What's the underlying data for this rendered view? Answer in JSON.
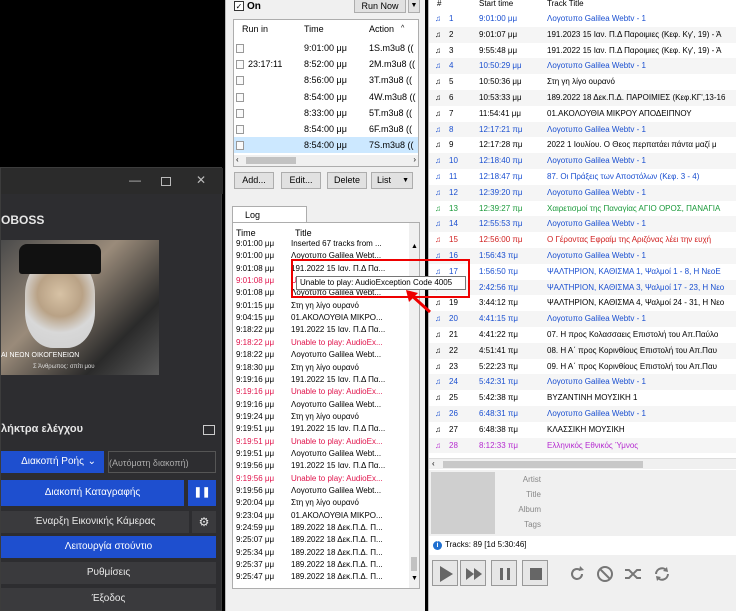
{
  "broadcaster": {
    "app_title": "OBOSS",
    "video_caption": "ΑΙ ΝΕΩΝ ΟΙΚΟΓΕΝΕΙΩΝ",
    "video_subcaption": "Σ Άνθρωπος: σπίτι μου",
    "controls_title": "λήκτρα ελέγχου",
    "stop_flow": "Διακοπή Ροής",
    "auto_stop": "(Αυτόματη διακοπή)",
    "stop_recording": "Διακοπή Καταγραφής",
    "start_webcam": "Έναρξη Εικονικής Κάμερας",
    "studio_mode": "Λειτουργία στούντιο",
    "settings": "Ρυθμίσεις",
    "exit": "Έξοδος"
  },
  "scheduler": {
    "on_label": "On",
    "run_now": "Run Now",
    "columns": [
      "Run in",
      "Time",
      "Action"
    ],
    "rows": [
      {
        "run_in": "",
        "time": "9:01:00 μμ",
        "action": "1S.m3u8 (("
      },
      {
        "run_in": "23:17:11",
        "time": "8:52:00 μμ",
        "action": "2M.m3u8 (("
      },
      {
        "run_in": "",
        "time": "8:56:00 μμ",
        "action": "3T.m3u8 (("
      },
      {
        "run_in": "",
        "time": "8:54:00 μμ",
        "action": "4W.m3u8 (("
      },
      {
        "run_in": "",
        "time": "8:33:00 μμ",
        "action": "5T.m3u8 (("
      },
      {
        "run_in": "",
        "time": "8:54:00 μμ",
        "action": "6F.m3u8 (("
      },
      {
        "run_in": "",
        "time": "8:54:00 μμ",
        "action": "7S.m3u8 (("
      }
    ],
    "buttons": [
      "Add...",
      "Edit...",
      "Delete",
      "List"
    ]
  },
  "log": {
    "tab": "Log",
    "columns": [
      "Time",
      "Title"
    ],
    "rows": [
      {
        "time": "9:01:00 μμ",
        "title": "Inserted 67 tracks from ...",
        "err": false
      },
      {
        "time": "9:01:00 μμ",
        "title": "Λογοτυπο Galilea Webt...",
        "err": false
      },
      {
        "time": "9:01:08 μμ",
        "title": "191.2022 15 Ιαν. Π.Δ Πα...",
        "err": false
      },
      {
        "time": "9:01:08 μμ",
        "title": "Unable to play: AudioEx...",
        "err": true
      },
      {
        "time": "9:01:08 μμ",
        "title": "Λογοτυπο Galilea Webt...",
        "err": false
      },
      {
        "time": "9:01:15 μμ",
        "title": "Στη γη λίγο ουρανό",
        "err": false
      },
      {
        "time": "9:04:15 μμ",
        "title": "01.ΑΚΟΛΟΥΘΙΑ ΜΙΚΡΟ...",
        "err": false
      },
      {
        "time": "9:18:22 μμ",
        "title": "191.2022 15 Ιαν. Π.Δ Πα...",
        "err": false
      },
      {
        "time": "9:18:22 μμ",
        "title": "Unable to play: AudioEx...",
        "err": true
      },
      {
        "time": "9:18:22 μμ",
        "title": "Λογοτυπο Galilea Webt...",
        "err": false
      },
      {
        "time": "9:18:30 μμ",
        "title": "Στη γη λίγο ουρανό",
        "err": false
      },
      {
        "time": "9:19:16 μμ",
        "title": "191.2022 15 Ιαν. Π.Δ Πα...",
        "err": false
      },
      {
        "time": "9:19:16 μμ",
        "title": "Unable to play: AudioEx...",
        "err": true
      },
      {
        "time": "9:19:16 μμ",
        "title": "Λογοτυπο Galilea Webt...",
        "err": false
      },
      {
        "time": "9:19:24 μμ",
        "title": "Στη γη λίγο ουρανό",
        "err": false
      },
      {
        "time": "9:19:51 μμ",
        "title": "191.2022 15 Ιαν. Π.Δ Πα...",
        "err": false
      },
      {
        "time": "9:19:51 μμ",
        "title": "Unable to play: AudioEx...",
        "err": true
      },
      {
        "time": "9:19:51 μμ",
        "title": "Λογοτυπο Galilea Webt...",
        "err": false
      },
      {
        "time": "9:19:56 μμ",
        "title": "191.2022 15 Ιαν. Π.Δ Πα...",
        "err": false
      },
      {
        "time": "9:19:56 μμ",
        "title": "Unable to play: AudioEx...",
        "err": true
      },
      {
        "time": "9:19:56 μμ",
        "title": "Λογοτυπο Galilea Webt...",
        "err": false
      },
      {
        "time": "9:20:04 μμ",
        "title": "Στη γη λίγο ουρανό",
        "err": false
      },
      {
        "time": "9:23:04 μμ",
        "title": "01.ΑΚΟΛΟΥΘΙΑ ΜΙΚΡΟ...",
        "err": false
      },
      {
        "time": "9:24:59 μμ",
        "title": "189.2022 18 Δεκ.Π.Δ. Π...",
        "err": false
      },
      {
        "time": "9:25:07 μμ",
        "title": "189.2022 18 Δεκ.Π.Δ. Π...",
        "err": false
      },
      {
        "time": "9:25:34 μμ",
        "title": "189.2022 18 Δεκ.Π.Δ. Π...",
        "err": false
      },
      {
        "time": "9:25:37 μμ",
        "title": "189.2022 18 Δεκ.Π.Δ. Π...",
        "err": false
      },
      {
        "time": "9:25:47 μμ",
        "title": "189.2022 18 Δεκ.Π.Δ. Π...",
        "err": false
      }
    ],
    "tooltip": "Unable to play: AudioException Code 4005"
  },
  "playlist": {
    "columns": [
      "#",
      "Start time",
      "Track Title"
    ],
    "rows": [
      {
        "n": "1",
        "time": "9:01:00 μμ",
        "title": "Λογοτυπο Galilea Webtv - 1",
        "color": "#1a4fd0"
      },
      {
        "n": "2",
        "time": "9:01:07 μμ",
        "title": "191.2023 15 Ιαν. Π.Δ Παροιμιες (Κεφ. Κγ', 19) - Ά",
        "color": "#000000"
      },
      {
        "n": "3",
        "time": "9:55:48 μμ",
        "title": "191.2022 15 Ιαν. Π.Δ Παροιμιες (Κεφ. Κγ', 19) - Ά",
        "color": "#000000"
      },
      {
        "n": "4",
        "time": "10:50:29 μμ",
        "title": "Λογοτυπο Galilea Webtv - 1",
        "color": "#1a4fd0"
      },
      {
        "n": "5",
        "time": "10:50:36 μμ",
        "title": "Στη γη λίγο ουρανό",
        "color": "#000000"
      },
      {
        "n": "6",
        "time": "10:53:33 μμ",
        "title": "189.2022 18 Δεκ.Π.Δ. ΠΑΡΟΙΜΙΕΣ (Κεφ.ΚΓ',13-16",
        "color": "#000000"
      },
      {
        "n": "7",
        "time": "11:54:41 μμ",
        "title": "01.ΑΚΟΛΟΥΘΙΑ ΜΙΚΡΟΥ ΑΠΟΔΕΙΠΝΟΥ",
        "color": "#000000"
      },
      {
        "n": "8",
        "time": "12:17:21 πμ",
        "title": "Λογοτυπο Galilea Webtv - 1",
        "color": "#1a4fd0"
      },
      {
        "n": "9",
        "time": "12:17:28 πμ",
        "title": "2022 1 Ιουλίου. Ο Θεος περπατάει πάντα μαζί μ",
        "color": "#000000"
      },
      {
        "n": "10",
        "time": "12:18:40 πμ",
        "title": "Λογοτυπο Galilea Webtv - 1",
        "color": "#1a4fd0"
      },
      {
        "n": "11",
        "time": "12:18:47 πμ",
        "title": "87. Οι Πράξεις των Αποστόλων (Κεφ. 3 - 4)",
        "color": "#1a4fd0"
      },
      {
        "n": "12",
        "time": "12:39:20 πμ",
        "title": "Λογοτυπο Galilea Webtv - 1",
        "color": "#1a4fd0"
      },
      {
        "n": "13",
        "time": "12:39:27 πμ",
        "title": "Χαιρετισμοί της Παναγίας ΑΓΙΟ ΟΡΟΣ, ΠΑΝΑΓΙΑ",
        "color": "#1a9a3a"
      },
      {
        "n": "14",
        "time": "12:55:53 πμ",
        "title": "Λογοτυπο Galilea Webtv - 1",
        "color": "#1a4fd0"
      },
      {
        "n": "15",
        "time": "12:56:00 πμ",
        "title": "Ο Γέροντας Εφραίμ της Αριζόνας λέει την ευχή",
        "color": "#d02020"
      },
      {
        "n": "16",
        "time": "1:56:43 πμ",
        "title": "Λογοτυπο Galilea Webtv - 1",
        "color": "#1a4fd0"
      },
      {
        "n": "17",
        "time": "1:56:50 πμ",
        "title": "ΨΑΛΤΗΡΙΟΝ, ΚΑΘΙΣΜΑ 1, Ψαλμοί 1 - 8, Η ΝεοΕ",
        "color": "#1a4fd0"
      },
      {
        "n": "18",
        "time": "2:42:56 πμ",
        "title": "ΨΑΛΤΗΡΙΟΝ, ΚΑΘΙΣΜΑ 3, Ψαλμοί 17 - 23, Η Νεο",
        "color": "#1a4fd0"
      },
      {
        "n": "19",
        "time": "3:44:12 πμ",
        "title": "ΨΑΛΤΗΡΙΟΝ, ΚΑΘΙΣΜΑ 4, Ψαλμοί 24 - 31, Η Νεο",
        "color": "#000000"
      },
      {
        "n": "20",
        "time": "4:41:15 πμ",
        "title": "Λογοτυπο Galilea Webtv - 1",
        "color": "#1a4fd0"
      },
      {
        "n": "21",
        "time": "4:41:22 πμ",
        "title": "07. Η προς Κολασσαεις Επιστολή του Απ.Παύλο",
        "color": "#000000"
      },
      {
        "n": "22",
        "time": "4:51:41 πμ",
        "title": "08. Η Α΄ προς Κορινθίους Επιστολή του Απ.Παυ",
        "color": "#000000"
      },
      {
        "n": "23",
        "time": "5:22:23 πμ",
        "title": "09. Η Α΄ προς Κορινθίους Επιστολή του Απ.Παυ",
        "color": "#000000"
      },
      {
        "n": "24",
        "time": "5:42:31 πμ",
        "title": "Λογοτυπο Galilea Webtv - 1",
        "color": "#1a4fd0"
      },
      {
        "n": "25",
        "time": "5:42:38 πμ",
        "title": "ΒΥΖΑΝΤΙΝΗ ΜΟΥΣΙΚΗ 1",
        "color": "#000000"
      },
      {
        "n": "26",
        "time": "6:48:31 πμ",
        "title": "Λογοτυπο Galilea Webtv - 1",
        "color": "#1a4fd0"
      },
      {
        "n": "27",
        "time": "6:48:38 πμ",
        "title": "ΚΛΑΣΣΙΚΗ ΜΟΥΣΙΚΗ",
        "color": "#000000"
      },
      {
        "n": "28",
        "time": "8:12:33 πμ",
        "title": "Ελληνικός Εθνικός Ύμνος",
        "color": "#b52bd0"
      }
    ],
    "info_labels": [
      "Artist",
      "Title",
      "Album",
      "Tags"
    ],
    "tracks_summary": "Tracks: 89 [1d 5:30:46]"
  }
}
